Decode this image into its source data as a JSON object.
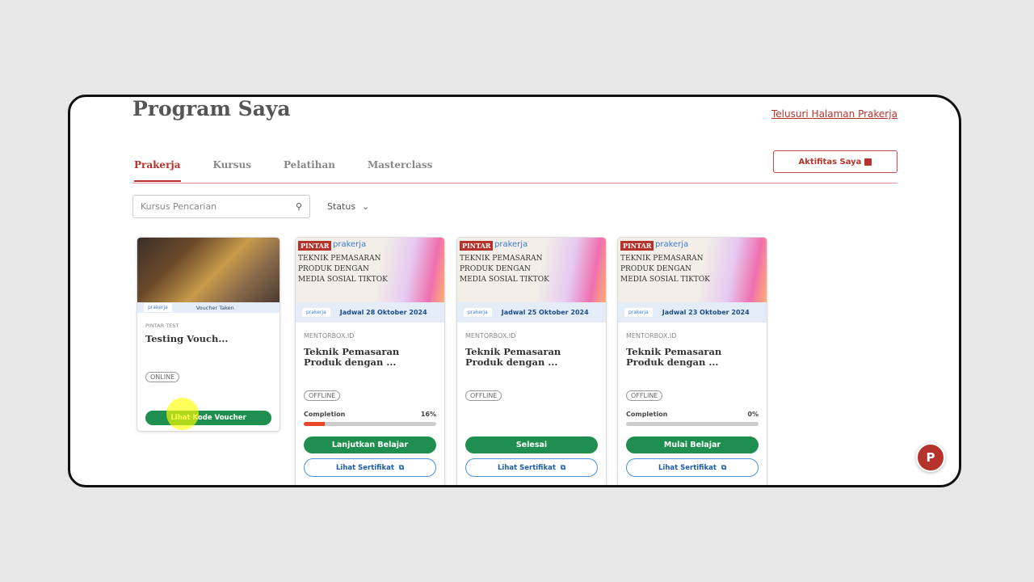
{
  "header": {
    "title": "Program Saya",
    "link": "Telusuri Halaman Prakerja",
    "activity_button": "Aktifitas Saya"
  },
  "tabs": [
    {
      "label": "Prakerja",
      "active": true
    },
    {
      "label": "Kursus"
    },
    {
      "label": "Pelatihan"
    },
    {
      "label": "Masterclass"
    }
  ],
  "search": {
    "placeholder": "Kursus Pencarian"
  },
  "filter": {
    "status_label": "Status"
  },
  "voucher_card": {
    "strip": "Voucher Taken",
    "logo": "prakerja",
    "provider": "PINTAR TEST",
    "title": "Testing Vouch...",
    "mode": "ONLINE",
    "button": "Lihat Kode Voucher"
  },
  "banner": {
    "pintar": "PINTAR",
    "prakerja": "prakerja",
    "text": "TEKNIK PEMASARAN PRODUK DENGAN MEDIA SOSIAL TIKTOK"
  },
  "courses": [
    {
      "schedule": "Jadwal 28 Oktober 2024",
      "provider": "MENTORBOX.ID",
      "title": "Teknik Pemasaran Produk dengan ...",
      "mode": "OFFLINE",
      "completion_label": "Completion",
      "completion": "16%",
      "progress": 16,
      "button": "Lanjutkan Belajar",
      "cert": "Lihat Sertifikat"
    },
    {
      "schedule": "Jadwal 25 Oktober 2024",
      "provider": "MENTORBOX.ID",
      "title": "Teknik Pemasaran Produk dengan ...",
      "mode": "OFFLINE",
      "button": "Selesai",
      "cert": "Lihat Sertifikat"
    },
    {
      "schedule": "Jadwal 23 Oktober 2024",
      "provider": "MENTORBOX.ID",
      "title": "Teknik Pemasaran Produk dengan ...",
      "mode": "OFFLINE",
      "completion_label": "Completion",
      "completion": "0%",
      "progress": 0,
      "button": "Mulai Belajar",
      "cert": "Lihat Sertifikat"
    }
  ],
  "chat": {
    "letter": "P"
  }
}
